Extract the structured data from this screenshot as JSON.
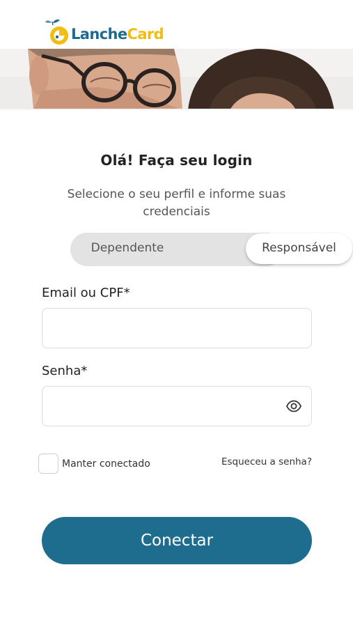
{
  "brand": {
    "name_part1": "Lanche",
    "name_part2": "Card",
    "blue": "#1d6b90",
    "yellow": "#f2bd13"
  },
  "login": {
    "title": "Olá! Faça seu login",
    "subtitle": "Selecione o seu perfil e informe suas credenciais"
  },
  "profile_toggle": {
    "options": [
      "Dependente",
      "Responsável"
    ],
    "selected": "Responsável"
  },
  "form": {
    "email_label": "Email ou CPF*",
    "email_value": "",
    "password_label": "Senha*",
    "password_value": "",
    "password_icon": "eye-icon",
    "keep_connected_label": "Manter conectado",
    "keep_connected_checked": false,
    "forgot_label": "Esqueceu a senha?",
    "submit_label": "Conectar"
  },
  "colors": {
    "accent": "#1e6c8e",
    "toggle_bg": "#e3e3e3"
  }
}
